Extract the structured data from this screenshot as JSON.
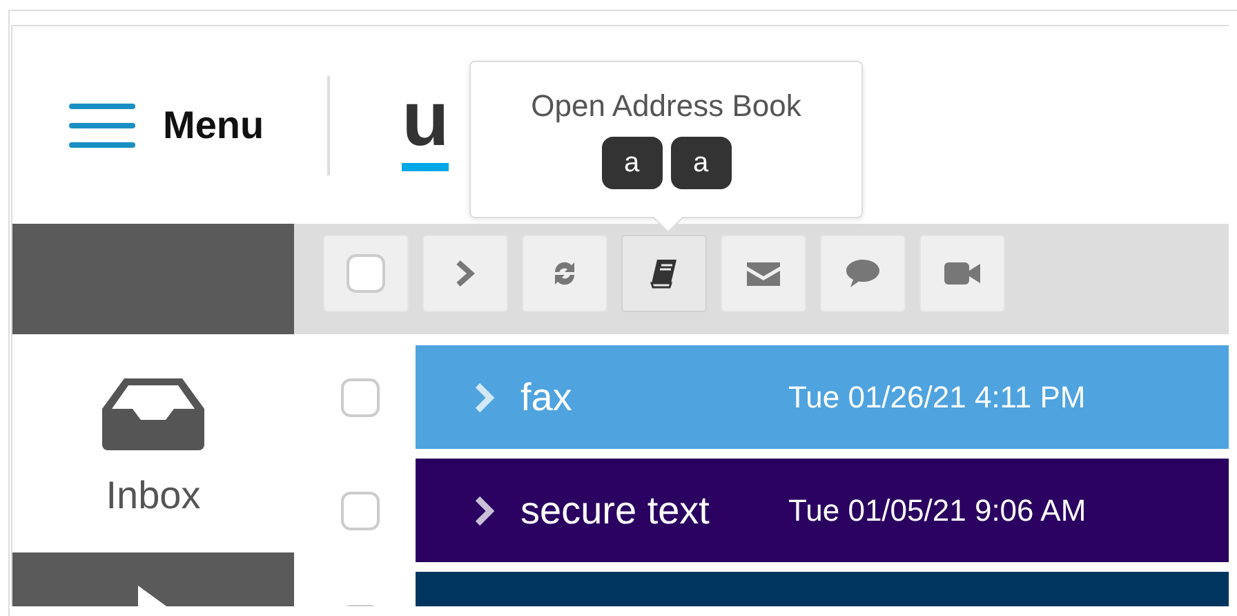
{
  "header": {
    "menu_label": "Menu",
    "logo_text": "u"
  },
  "tooltip": {
    "text": "Open Address Book",
    "keys": [
      "a",
      "a"
    ]
  },
  "toolbar": {
    "buttons": [
      {
        "kind": "checkbox",
        "selected": false
      },
      {
        "kind": "chevron",
        "selected": false
      },
      {
        "kind": "refresh",
        "selected": false
      },
      {
        "kind": "book",
        "selected": true
      },
      {
        "kind": "envelope",
        "selected": false
      },
      {
        "kind": "comment",
        "selected": false
      },
      {
        "kind": "video",
        "selected": false
      }
    ]
  },
  "sidebar": {
    "items": [
      {
        "kind": "inbox",
        "label": "Inbox",
        "selected": false
      },
      {
        "kind": "arrow",
        "selected": true
      }
    ]
  },
  "messages": [
    {
      "label": "fax",
      "time": "Tue 01/26/21 4:11 PM",
      "color": "#4fa3df",
      "checked": false
    },
    {
      "label": "secure text",
      "time": "Tue 01/05/21 9:06 AM",
      "color": "#2a0060",
      "checked": false
    },
    {
      "color": "#003560",
      "checked": false
    }
  ]
}
